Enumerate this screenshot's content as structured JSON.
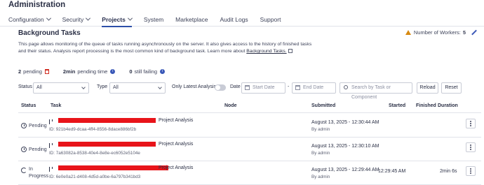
{
  "header": {
    "title": "Administration",
    "nav": [
      {
        "label": "Configuration",
        "dropdown": true,
        "active": false
      },
      {
        "label": "Security",
        "dropdown": true,
        "active": false
      },
      {
        "label": "Projects",
        "dropdown": true,
        "active": true
      },
      {
        "label": "System",
        "dropdown": false,
        "active": false
      },
      {
        "label": "Marketplace",
        "dropdown": false,
        "active": false
      },
      {
        "label": "Audit Logs",
        "dropdown": false,
        "active": false
      },
      {
        "label": "Support",
        "dropdown": false,
        "active": false
      }
    ]
  },
  "page": {
    "title": "Background Tasks",
    "workers_label": "Number of Workers:",
    "workers_count": "5",
    "description": "This page allows monitoring of the queue of tasks running asynchronously on the server. It also gives access to the history of finished tasks and their status. Analysis report processing is the most common kind of background task. Learn more about",
    "description_link": "Background Tasks."
  },
  "stats": {
    "pending_count": "2",
    "pending_label": "pending",
    "pending_time_value": "2min",
    "pending_time_label": "pending time",
    "failing_count": "0",
    "failing_label": "still failing"
  },
  "filters": {
    "status_label": "Status",
    "status_value": "All",
    "type_label": "Type",
    "type_value": "All",
    "latest_label": "Only Latest Analysis",
    "latest_on": false,
    "date_label": "Date",
    "start_placeholder": "Start Date",
    "date_sep": "-",
    "end_placeholder": "End Date",
    "search_placeholder": "Search by Task or Component",
    "reload_label": "Reload",
    "reset_label": "Reset"
  },
  "table": {
    "columns": {
      "status": "Status",
      "task": "Task",
      "node": "Node",
      "submitted": "Submitted",
      "started": "Started",
      "finished": "Finished",
      "duration": "Duration"
    },
    "rows": [
      {
        "status": "Pending",
        "kind": "Project Analysis",
        "id": "ID: 921b4ed9-dcaa-4ff4-8556-8dace886bf2b",
        "submitted": "August 13, 2025 - 12:30:44 AM",
        "by": "By admin",
        "started": "",
        "finished": "",
        "duration": ""
      },
      {
        "status": "Pending",
        "kind": "Project Analysis",
        "id": "ID: 7a63082a-8538-40e4-8e8e-ec6052e5104e",
        "submitted": "August 13, 2025 - 12:30:10 AM",
        "by": "By admin",
        "started": "",
        "finished": "",
        "duration": ""
      },
      {
        "status_line1": "In",
        "status_line2": "Progress",
        "kind": "Project Analysis",
        "id": "ID: 6e0e0a21-d408-4d5d-a0be-6a797b341bd3",
        "submitted": "August 13, 2025 - 12:29:44 AM",
        "by": "By admin",
        "started": "12:29:45 AM",
        "finished": "",
        "duration": "2min 6s"
      }
    ]
  },
  "colors": {
    "accent": "#2d4fa8",
    "redaction": "#e8141a",
    "warning": "#d78a12"
  }
}
